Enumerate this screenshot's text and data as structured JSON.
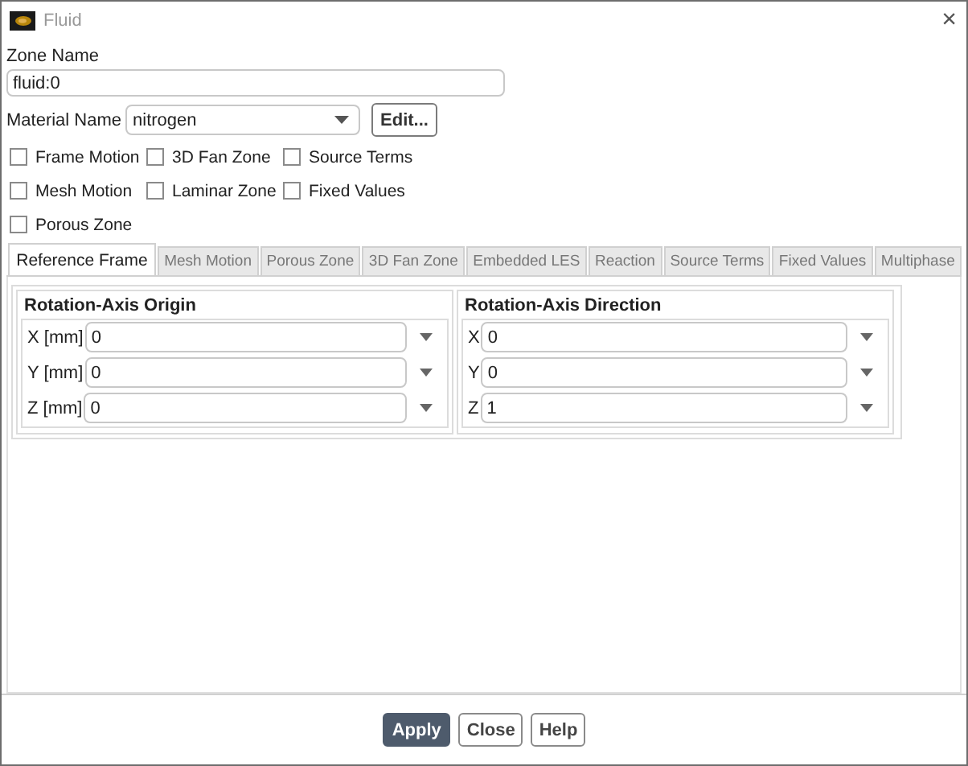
{
  "window": {
    "title": "Fluid",
    "close": "×"
  },
  "zone_name": {
    "label": "Zone Name",
    "value": "fluid:0"
  },
  "material": {
    "label": "Material Name",
    "value": "nitrogen",
    "edit_button": "Edit..."
  },
  "options": [
    {
      "label": "Frame Motion",
      "checked": false
    },
    {
      "label": "3D Fan Zone",
      "checked": false
    },
    {
      "label": "Source Terms",
      "checked": false
    },
    {
      "label": "Mesh Motion",
      "checked": false
    },
    {
      "label": "Laminar Zone",
      "checked": false
    },
    {
      "label": "Fixed Values",
      "checked": false
    },
    {
      "label": "Porous Zone",
      "checked": false
    }
  ],
  "tabs": [
    {
      "label": "Reference Frame",
      "selected": true
    },
    {
      "label": "Mesh Motion",
      "selected": false
    },
    {
      "label": "Porous Zone",
      "selected": false
    },
    {
      "label": "3D Fan Zone",
      "selected": false
    },
    {
      "label": "Embedded LES",
      "selected": false
    },
    {
      "label": "Reaction",
      "selected": false
    },
    {
      "label": "Source Terms",
      "selected": false
    },
    {
      "label": "Fixed Values",
      "selected": false
    },
    {
      "label": "Multiphase",
      "selected": false
    }
  ],
  "groups": [
    {
      "title": "Rotation-Axis Origin",
      "fields": [
        {
          "label": "X [mm]",
          "value": "0"
        },
        {
          "label": "Y [mm]",
          "value": "0"
        },
        {
          "label": "Z [mm]",
          "value": "0"
        }
      ]
    },
    {
      "title": "Rotation-Axis Direction",
      "fields": [
        {
          "label": "X",
          "value": "0"
        },
        {
          "label": "Y",
          "value": "0"
        },
        {
          "label": "Z",
          "value": "1"
        }
      ]
    }
  ],
  "buttons": [
    {
      "label": "Apply",
      "primary": true
    },
    {
      "label": "Close",
      "primary": false
    },
    {
      "label": "Help",
      "primary": false
    }
  ]
}
